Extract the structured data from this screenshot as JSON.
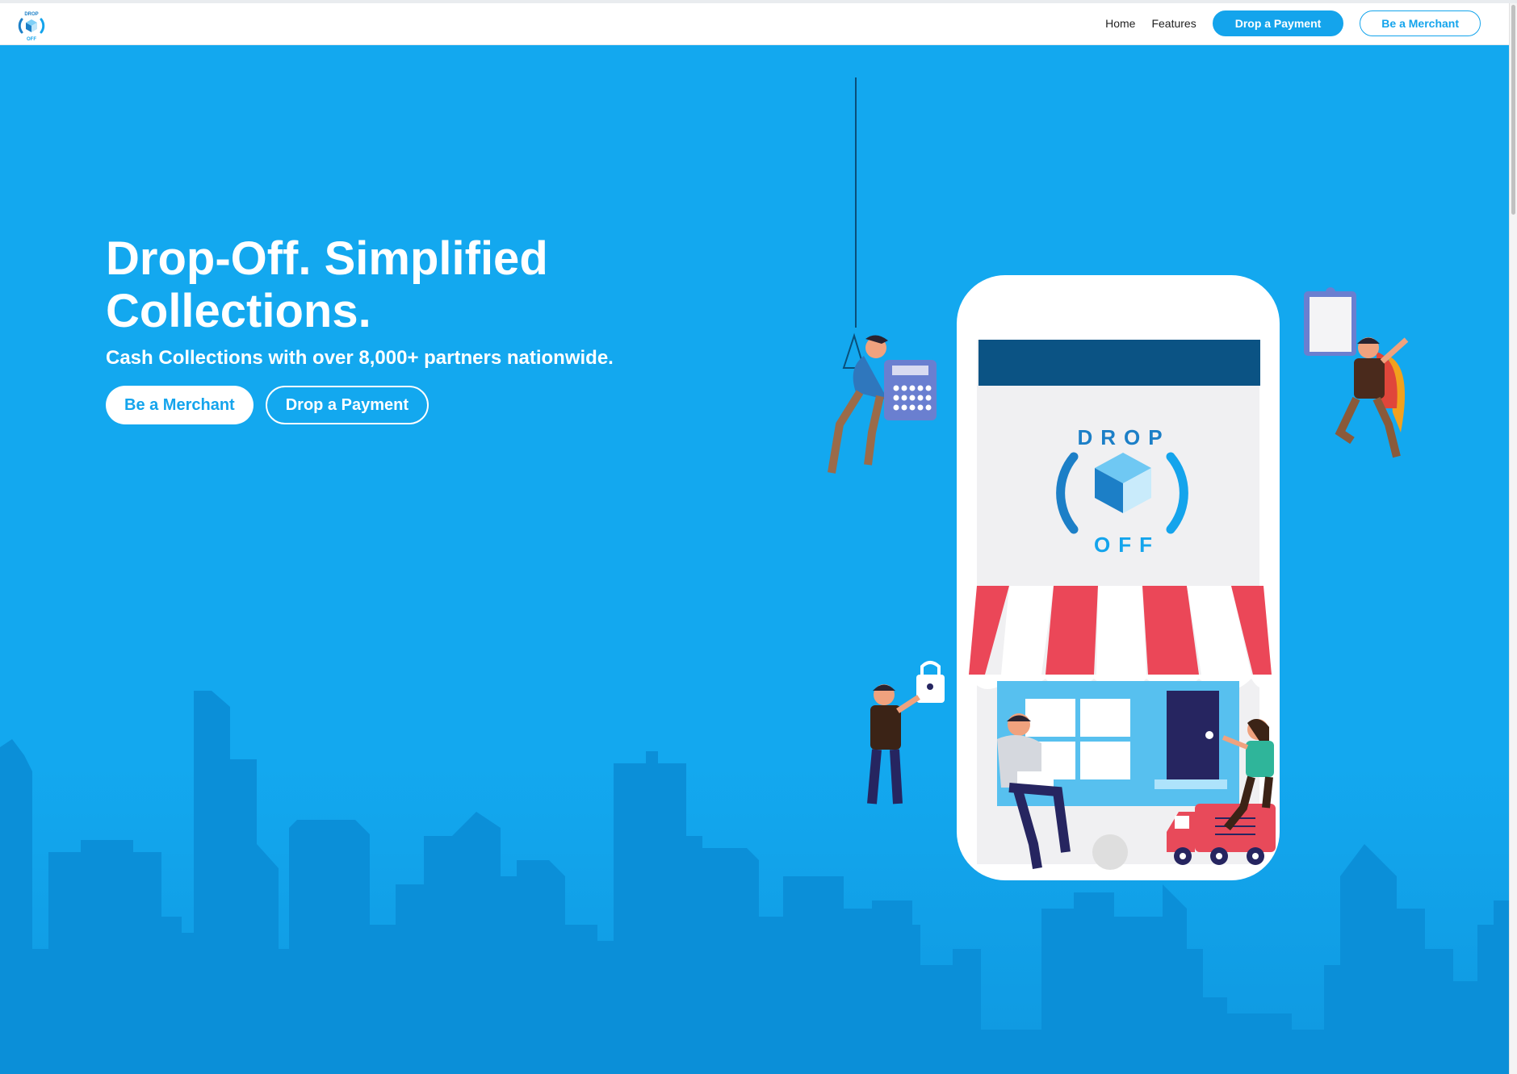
{
  "brand": {
    "logo_name": "drop-off-logo",
    "logo_text_top": "DROP",
    "logo_text_bottom": "OFF",
    "accent": "#14a4ec",
    "hero_bg": "#13a8ef",
    "skyline": "#0b8fd8"
  },
  "nav": {
    "home": "Home",
    "features": "Features",
    "drop_payment": "Drop a Payment",
    "be_merchant": "Be a Merchant"
  },
  "hero": {
    "title": "Drop-Off. Simplified Collections.",
    "subtitle": "Cash Collections with over 8,000+ partners nationwide.",
    "btn_merchant": "Be a Merchant",
    "btn_payment": "Drop a Payment"
  },
  "illustration": {
    "phone_logo_top": "DROP",
    "phone_logo_bottom": "OFF"
  }
}
